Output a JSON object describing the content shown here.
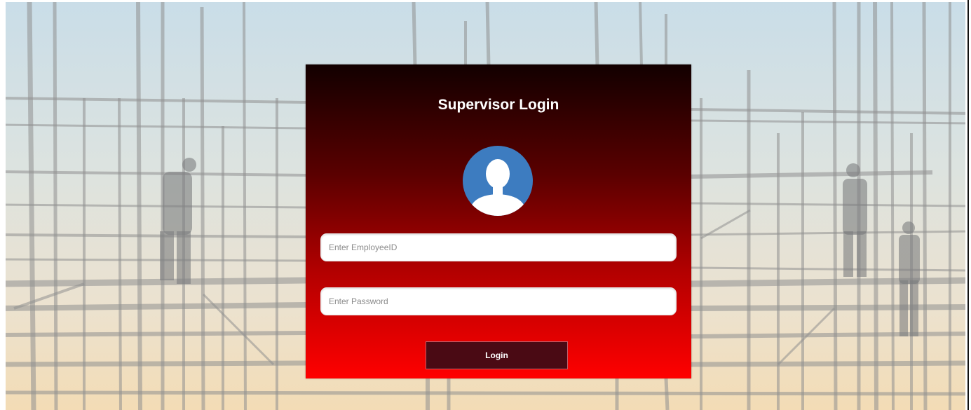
{
  "login": {
    "title": "Supervisor Login",
    "avatar_icon": "user-avatar-icon",
    "employee_id_placeholder": "Enter EmployeeID",
    "employee_id_value": "",
    "password_placeholder": "Enter Password",
    "password_value": "",
    "submit_label": "Login"
  },
  "colors": {
    "card_top": "#120000",
    "card_bottom": "#ff0000",
    "button_bg": "#4a0a14",
    "avatar_circle": "#3d7cc0"
  }
}
